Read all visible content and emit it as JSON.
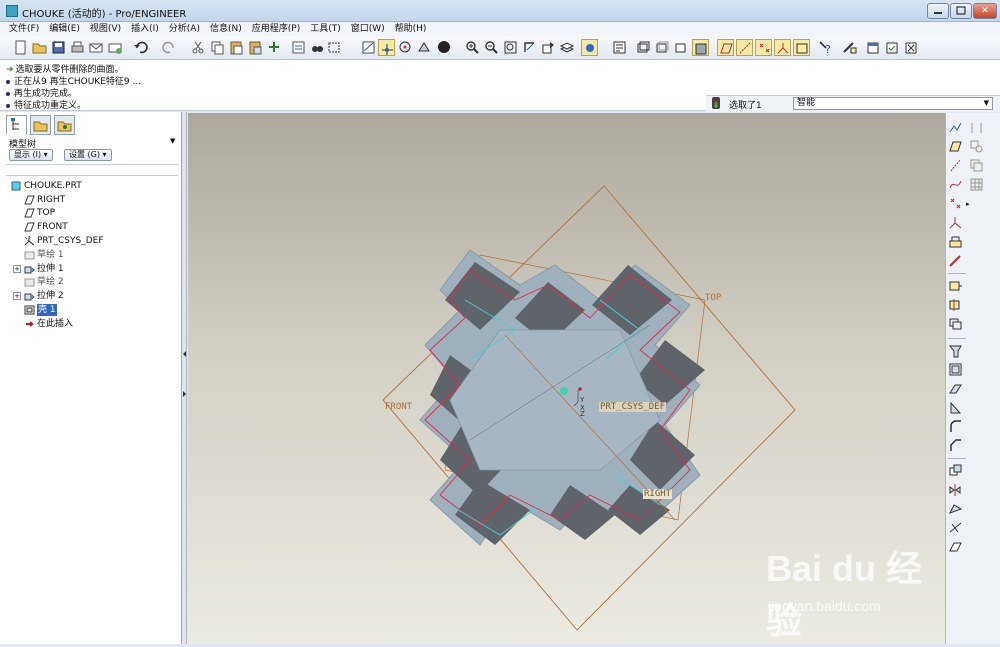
{
  "window": {
    "title": "CHOUKE (活动的) - Pro/ENGINEER",
    "min_icon": "minimize-icon",
    "max_icon": "maximize-icon",
    "close_label": "✕"
  },
  "menu": [
    "文件(F)",
    "编辑(E)",
    "视图(V)",
    "插入(I)",
    "分析(A)",
    "信息(N)",
    "应用程序(P)",
    "工具(T)",
    "窗口(W)",
    "帮助(H)"
  ],
  "messages": [
    {
      "kind": "prompt",
      "text": "选取要从零件删除的曲面。"
    },
    {
      "kind": "info",
      "text": "正在从9 再生CHOUKE特征9 ..."
    },
    {
      "kind": "info",
      "text": "再生成功完成。"
    },
    {
      "kind": "info",
      "text": "特征成功重定义。"
    }
  ],
  "selection": {
    "count_text": "选取了1",
    "filter_value": "智能"
  },
  "panel": {
    "tree_title": "模型树",
    "show_button": "显示 (I) ▾",
    "settings_button": "设置 (G) ▾"
  },
  "tree": [
    {
      "label": "CHOUKE.PRT",
      "icon": "part-icon",
      "indent": 0
    },
    {
      "label": "RIGHT",
      "icon": "datum-plane-icon",
      "indent": 1
    },
    {
      "label": "TOP",
      "icon": "datum-plane-icon",
      "indent": 1
    },
    {
      "label": "FRONT",
      "icon": "datum-plane-icon",
      "indent": 1
    },
    {
      "label": "PRT_CSYS_DEF",
      "icon": "csys-icon",
      "indent": 1
    },
    {
      "label": "草绘 1",
      "icon": "sketch-icon",
      "indent": 1
    },
    {
      "label": "拉伸 1",
      "icon": "extrude-icon",
      "indent": 1,
      "expandable": true
    },
    {
      "label": "草绘 2",
      "icon": "sketch-icon",
      "indent": 1
    },
    {
      "label": "拉伸 2",
      "icon": "extrude-icon",
      "indent": 1,
      "expandable": true
    },
    {
      "label": "壳 1",
      "icon": "shell-icon",
      "indent": 1,
      "selected": true
    },
    {
      "label": "在此插入",
      "icon": "insert-here-icon",
      "indent": 1
    }
  ],
  "viewport": {
    "datum_labels": [
      "TOP",
      "FRONT",
      "RIGHT",
      "PRT_CSYS_DEF"
    ],
    "axis_labels": [
      "Y",
      "X",
      "Z"
    ]
  },
  "watermark": {
    "text": "Bai du 经验",
    "sub": "jingyan.baidu.com"
  },
  "colors": {
    "datum_plane": "#b5702e",
    "edge_highlight": "#e0284a",
    "edge_cyan": "#3fd2d6",
    "model_face": "#9ba7b3",
    "model_dark": "#5c6168"
  }
}
